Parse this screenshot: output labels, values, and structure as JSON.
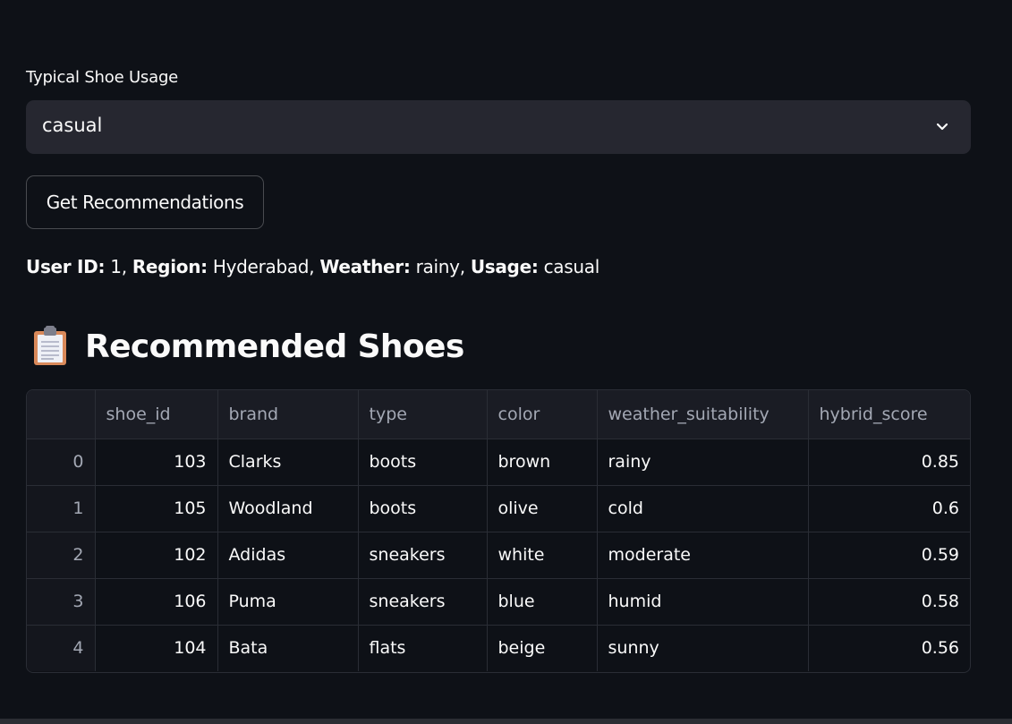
{
  "usage_select": {
    "label": "Typical Shoe Usage",
    "value": "casual"
  },
  "button": {
    "label": "Get Recommendations"
  },
  "info": {
    "user_id_label": "User ID:",
    "user_id": "1",
    "region_label": "Region:",
    "region": "Hyderabad",
    "weather_label": "Weather:",
    "weather": "rainy",
    "usage_label": "Usage:",
    "usage": "casual"
  },
  "section": {
    "icon": "clipboard-icon",
    "title": "Recommended Shoes"
  },
  "table": {
    "columns": [
      "",
      "shoe_id",
      "brand",
      "type",
      "color",
      "weather_suitability",
      "hybrid_score"
    ],
    "rows": [
      {
        "index": "0",
        "shoe_id": "103",
        "brand": "Clarks",
        "type": "boots",
        "color": "brown",
        "weather_suitability": "rainy",
        "hybrid_score": "0.85"
      },
      {
        "index": "1",
        "shoe_id": "105",
        "brand": "Woodland",
        "type": "boots",
        "color": "olive",
        "weather_suitability": "cold",
        "hybrid_score": "0.6"
      },
      {
        "index": "2",
        "shoe_id": "102",
        "brand": "Adidas",
        "type": "sneakers",
        "color": "white",
        "weather_suitability": "moderate",
        "hybrid_score": "0.59"
      },
      {
        "index": "3",
        "shoe_id": "106",
        "brand": "Puma",
        "type": "sneakers",
        "color": "blue",
        "weather_suitability": "humid",
        "hybrid_score": "0.58"
      },
      {
        "index": "4",
        "shoe_id": "104",
        "brand": "Bata",
        "type": "flats",
        "color": "beige",
        "weather_suitability": "sunny",
        "hybrid_score": "0.56"
      }
    ]
  },
  "colors": {
    "background": "#0e1117",
    "input_background": "#262730",
    "text": "#fafafa",
    "muted_text": "#a3a8b4"
  }
}
